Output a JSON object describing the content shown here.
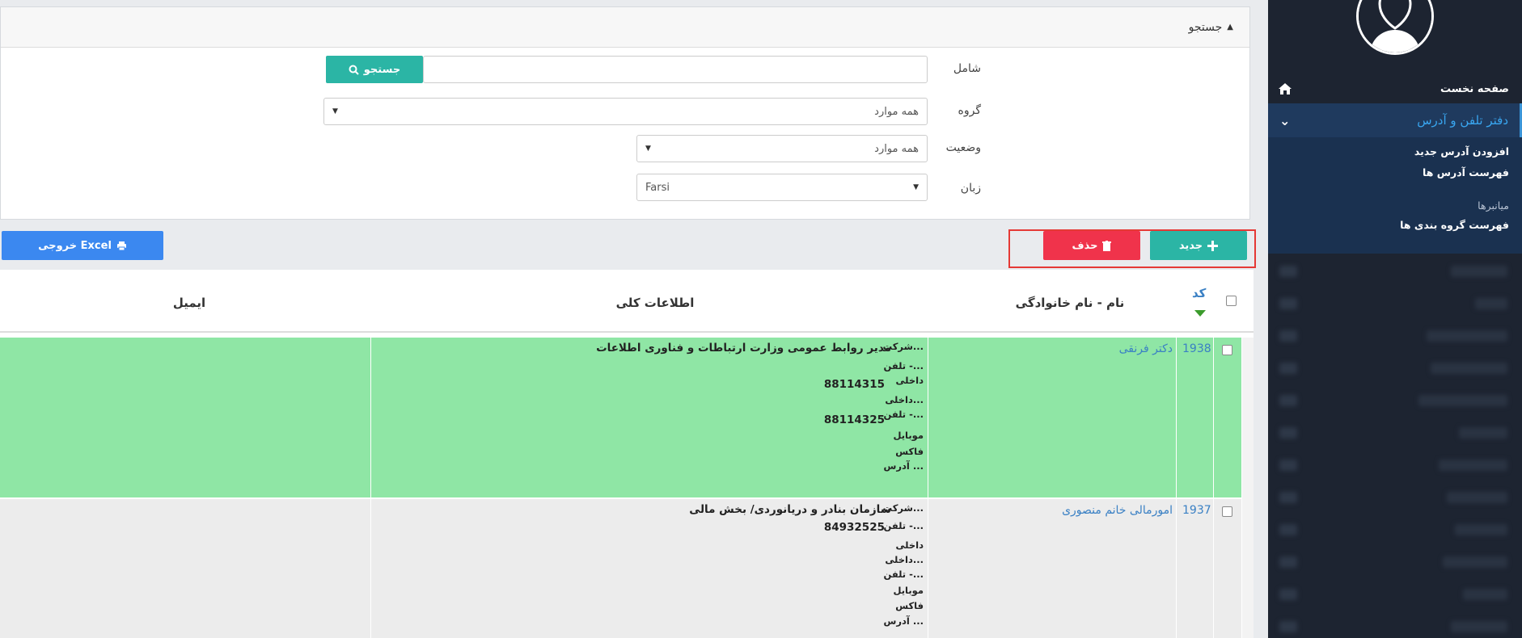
{
  "sidebar": {
    "home": "صفحه نخست",
    "section_title": "دفتر تلفن و آدرس",
    "items": [
      {
        "label": "افزودن آدرس جدید"
      },
      {
        "label": "فهرست آدرس ها"
      }
    ],
    "category": "میانبرها",
    "category_items": [
      {
        "label": "فهرست گروه بندی ها"
      }
    ]
  },
  "search": {
    "title": "جستجو",
    "fields": {
      "contains_label": "شامل",
      "group_label": "گروه",
      "status_label": "وضعیت",
      "language_label": "زبان"
    },
    "group_value": "همه موارد",
    "status_value": "همه موارد",
    "language_value": "Farsi",
    "search_button": "جستجو"
  },
  "actions": {
    "new": "جدید",
    "delete": "حذف",
    "excel": "خروجی Excel"
  },
  "table": {
    "headers": {
      "code": "کد",
      "name": "نام - نام خانوادگی",
      "info": "اطلاعات کلی",
      "email": "ایمیل"
    },
    "rows": [
      {
        "code": "1938",
        "name": "دکتر فرنقی",
        "company_label": "شرکت...",
        "company": "مدیر روابط عمومی وزارت ارتباطات و فناوری اطلاعات",
        "phone_label": "تلفن -...",
        "internal_label": "داخلی",
        "phone": "88114315",
        "internal2_label": "داخلی...",
        "phone2_label": "تلفن -...",
        "phone2": "88114325",
        "mobile_label": "موبایل",
        "fax_label": "فاکس",
        "address_label": "آدرس ..."
      },
      {
        "code": "1937",
        "name": "امورمالی خانم منصوری",
        "company_label": "شرکت...",
        "company": "سازمان بنادر و دریانوردی/ بخش مالی",
        "phone_label": "تلفن -...",
        "phone": "84932525",
        "internal_label": "داخلی",
        "internal2_label": "داخلی...",
        "phone2_label": "تلفن -...",
        "mobile_label": "موبایل",
        "fax_label": "فاکس",
        "address_label": "آدرس ..."
      }
    ]
  },
  "colors": {
    "teal": "#2bb5a5",
    "red": "#f0334b",
    "blue": "#3b88f0",
    "row_highlight": "#8fe6a5",
    "sidebar": "#1d2431",
    "link": "#3a80c4"
  }
}
